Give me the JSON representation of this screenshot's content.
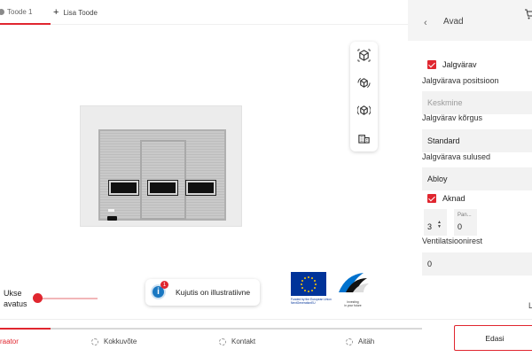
{
  "tabs": [
    {
      "label": "Toode 1",
      "active": true
    },
    {
      "label": "Lisa Toode",
      "icon": "plus-icon"
    }
  ],
  "view_tools": [
    "cube-front-icon",
    "cube-rotate-icon",
    "cube-side-icon",
    "building-icon"
  ],
  "slider": {
    "label": "Ukse avatus",
    "value": 0
  },
  "info": {
    "text": "Kujutis on illustratiivne",
    "badge": "1"
  },
  "eu_logo": {
    "line1": "Funded by the European Union",
    "line2": "NextGenerationEU"
  },
  "ee_logo": {
    "line1": "Investing",
    "line2": "in your future"
  },
  "panel": {
    "title": "Avad",
    "jalgvarav_checkbox": {
      "label": "Jalgvärav",
      "checked": true
    },
    "position_label": "Jalgvärava positsioon",
    "position_placeholder": "Keskmine",
    "height_label": "Jalgvärav kõrgus",
    "height_value": "Standard",
    "lock_label": "Jalgvärava sulused",
    "lock_value": "Abloy",
    "windows_checkbox": {
      "label": "Aknad",
      "checked": true
    },
    "count_value": "3",
    "panel_label": "Pan...",
    "panel_value": "0",
    "vent_label": "Ventilatsioonirest",
    "vent_value": "0",
    "cut_letter": "L"
  },
  "steps": [
    {
      "label": "Konfiguraator",
      "visible_text": "raator",
      "active": true
    },
    {
      "label": "Kokkuvõte",
      "active": false
    },
    {
      "label": "Kontakt",
      "active": false
    },
    {
      "label": "Aitäh",
      "active": false
    }
  ],
  "progress": 0.12,
  "next_button": "Edasi",
  "colors": {
    "accent": "#e0262f",
    "info": "#1a78c2",
    "eu_blue": "#003399"
  }
}
